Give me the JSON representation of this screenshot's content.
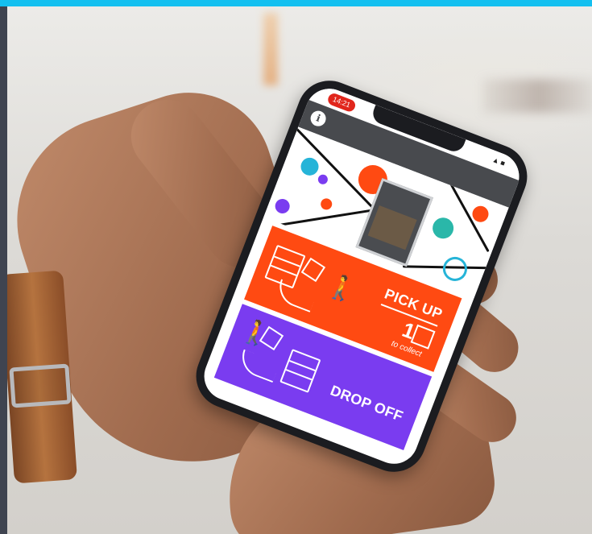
{
  "status_bar": {
    "time": "14:21",
    "icons": "▲■"
  },
  "header": {
    "info_label": "i"
  },
  "tiles": {
    "pickup": {
      "title": "PICK UP",
      "count": "1",
      "subtitle": "to collect",
      "color": "#ff4a12"
    },
    "dropoff": {
      "title": "DROP OFF",
      "color": "#7a3cf0"
    }
  },
  "colors": {
    "top_bar": "#14c0f0",
    "header": "#484a4e",
    "time_pill": "#e1261c"
  },
  "icons": {
    "pickup": [
      "locker-icon",
      "box-icon",
      "person-icon",
      "curved-arrow-icon"
    ],
    "dropoff": [
      "person-icon",
      "box-icon",
      "locker-icon",
      "curved-arrow-icon"
    ]
  }
}
